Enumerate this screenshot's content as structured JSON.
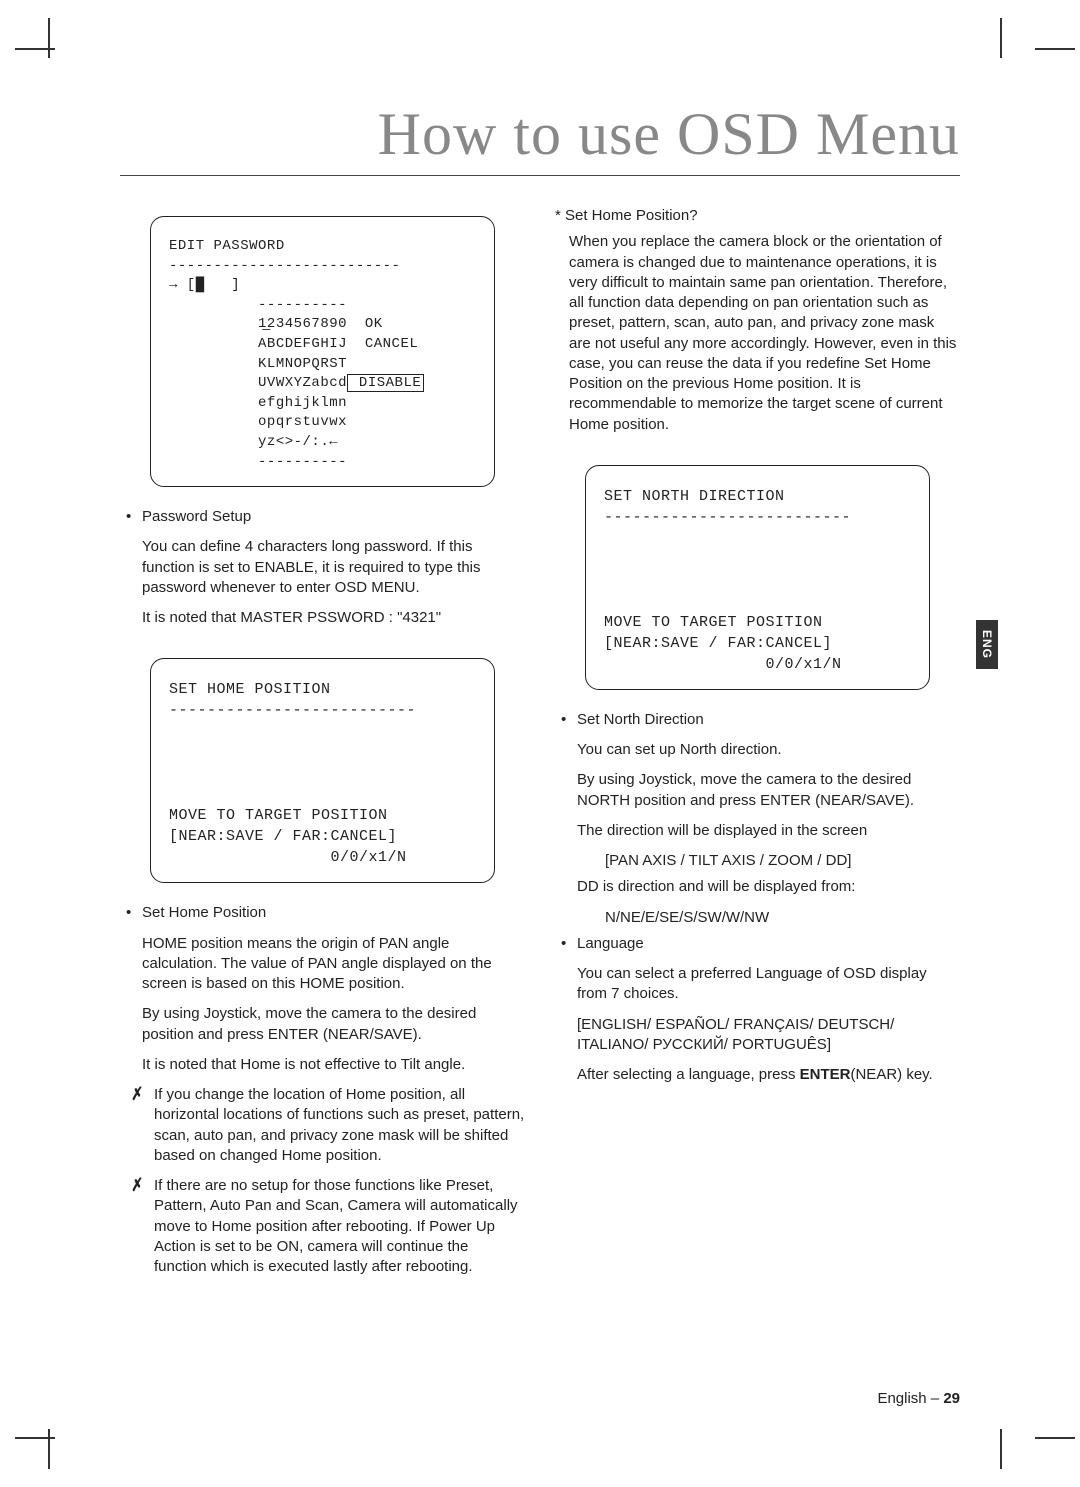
{
  "title": "How to use OSD Menu",
  "langTab": "ENG",
  "osd1": {
    "line1": "EDIT PASSWORD",
    "line2": "--------------------------",
    "line3": "→ [█   ]",
    "line4": "          ----------",
    "line5a": "          1̲234567890",
    "line5b": "  OK",
    "line6a": "          ABCDEFGHIJ",
    "line6b": "  CANCEL",
    "line7": "          KLMNOPQRST",
    "line8a": "          UVWXYZabcd",
    "line8b": " DISABLE",
    "line9": "          efghijklmn",
    "line10": "          opqrstuvwx",
    "line11": "          yz<>-/:.←",
    "line12": "          ----------"
  },
  "left": {
    "pwd_title": "Password Setup",
    "pwd_body1": "You can define 4 characters long password. If this function is set to ENABLE, it is required to type this password whenever to enter OSD MENU.",
    "pwd_body2": "It is noted that MASTER PSSWORD : \"4321\""
  },
  "osd2": {
    "line1": "SET HOME POSITION",
    "line2": "--------------------------",
    "line3": "MOVE TO TARGET POSITION",
    "line4": "[NEAR:SAVE / FAR:CANCEL]",
    "line5": "                 0/0/x1/N"
  },
  "home": {
    "title": "Set Home Position",
    "p1": "HOME position means the origin of PAN angle calculation. The value of PAN angle displayed on the screen is based on this HOME position.",
    "p2": "By using Joystick, move the camera to the desired position and press ENTER (NEAR/SAVE).",
    "p3": "It is noted that Home is not effective to Tilt angle.",
    "n1": "If you change the location of Home position, all horizontal locations of functions such as preset, pattern, scan, auto pan, and privacy zone mask will be shifted based on changed Home position.",
    "n2": "If there are no setup for those functions like Preset, Pattern, Auto Pan and Scan, Camera will automatically move to Home position after rebooting. If Power Up Action is set to be ON, camera will continue the function which is executed lastly after rebooting."
  },
  "right": {
    "q_title": "* Set Home Position?",
    "q_body": "When you replace the camera block or the orientation of camera is changed due to maintenance operations, it is very difficult to maintain same pan orientation. Therefore, all function data depending on pan orientation such as preset, pattern, scan, auto pan, and privacy zone mask are not useful any more accordingly. However, even in this case, you can reuse the data if you redefine Set Home Position on the previous Home position. It is recommendable to memorize the target scene of current Home position."
  },
  "osd3": {
    "line1": "SET NORTH DIRECTION",
    "line2": "--------------------------",
    "line3": "MOVE TO TARGET POSITION",
    "line4": "[NEAR:SAVE / FAR:CANCEL]",
    "line5": "                 0/0/x1/N"
  },
  "north": {
    "title": "Set North Direction",
    "p1": "You can set up North direction.",
    "p2": "By using Joystick, move the camera to the desired NORTH position and press ENTER (NEAR/SAVE).",
    "p3": "The direction will be displayed in the screen",
    "p3a": "[PAN AXIS / TILT AXIS / ZOOM / DD]",
    "p4": "DD is direction and will be displayed from:",
    "p4a": "N/NE/E/SE/S/SW/W/NW"
  },
  "lang": {
    "title": "Language",
    "p1": "You can select a preferred Language of OSD display from 7 choices.",
    "p2": "[ENGLISH/ ESPAÑOL/ FRANÇAIS/ DEUTSCH/ ITALIANO/ РУССКИЙ/ PORTUGUÊS]",
    "p3a": "After selecting a language, press ",
    "p3b": "ENTER",
    "p3c": "(NEAR) key."
  },
  "footer": {
    "lang": "English – ",
    "page": "29"
  }
}
